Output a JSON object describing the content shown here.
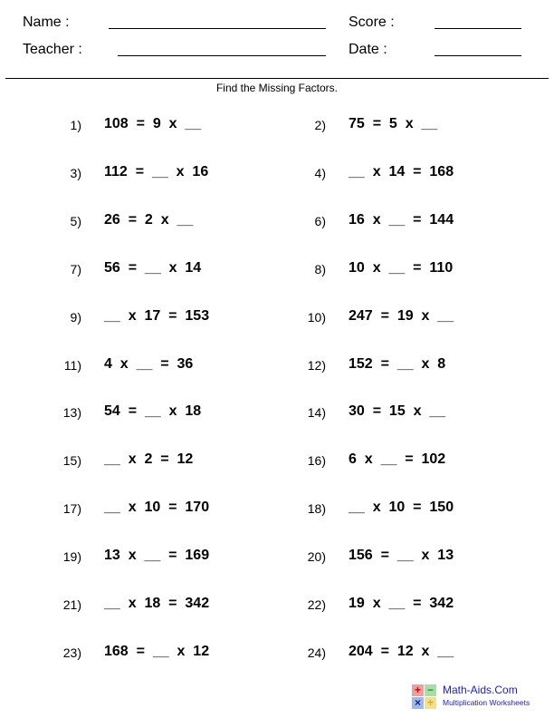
{
  "header": {
    "name_label": "Name :",
    "teacher_label": "Teacher :",
    "score_label": "Score :",
    "date_label": "Date :"
  },
  "instructions": "Find the Missing Factors.",
  "problems": [
    {
      "num": "1)",
      "eq": "108  =  9  x  __"
    },
    {
      "num": "2)",
      "eq": "75  =  5  x  __"
    },
    {
      "num": "3)",
      "eq": "112  =  __  x  16"
    },
    {
      "num": "4)",
      "eq": "__  x  14  =  168"
    },
    {
      "num": "5)",
      "eq": "26  =  2  x  __"
    },
    {
      "num": "6)",
      "eq": "16  x  __  =  144"
    },
    {
      "num": "7)",
      "eq": "56  =  __  x  14"
    },
    {
      "num": "8)",
      "eq": "10  x  __  =  110"
    },
    {
      "num": "9)",
      "eq": "__  x  17  =  153"
    },
    {
      "num": "10)",
      "eq": "247  =  19  x  __"
    },
    {
      "num": "11)",
      "eq": "4  x  __  =  36"
    },
    {
      "num": "12)",
      "eq": "152  =  __  x  8"
    },
    {
      "num": "13)",
      "eq": "54  =  __  x  18"
    },
    {
      "num": "14)",
      "eq": "30  =  15  x  __"
    },
    {
      "num": "15)",
      "eq": "__  x  2  =  12"
    },
    {
      "num": "16)",
      "eq": "6  x  __  =  102"
    },
    {
      "num": "17)",
      "eq": "__  x  10  =  170"
    },
    {
      "num": "18)",
      "eq": "__  x  10  =  150"
    },
    {
      "num": "19)",
      "eq": "13  x  __  =  169"
    },
    {
      "num": "20)",
      "eq": "156  =  __  x  13"
    },
    {
      "num": "21)",
      "eq": "__  x  18  =  342"
    },
    {
      "num": "22)",
      "eq": "19  x  __  =  342"
    },
    {
      "num": "23)",
      "eq": "168  =  __  x  12"
    },
    {
      "num": "24)",
      "eq": "204  =  12  x  __"
    }
  ],
  "logo": {
    "title": "Math-Aids.Com",
    "subtitle": "Multiplication Worksheets",
    "tiles": [
      {
        "symbol": "+",
        "bg": "#e8a0a0",
        "fg": "#d40000"
      },
      {
        "symbol": "−",
        "bg": "#a8dca8",
        "fg": "#1e9a1e"
      },
      {
        "symbol": "×",
        "bg": "#a0b8e8",
        "fg": "#0a2a8a"
      },
      {
        "symbol": "÷",
        "bg": "#f0e090",
        "fg": "#d8a000"
      }
    ],
    "text_color": "#1a1ad6"
  }
}
